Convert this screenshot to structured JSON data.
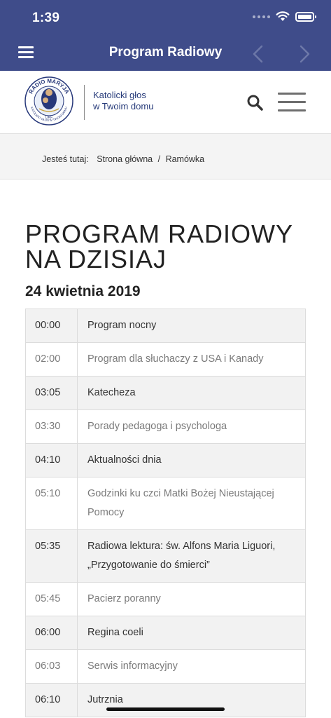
{
  "status_bar": {
    "time": "1:39"
  },
  "nav": {
    "title": "Program Radiowy"
  },
  "header": {
    "logo_text_top": "RADIO MARYJA",
    "logo_text_bottom": "KATOLICKI GŁOS W TWOIM DOMU",
    "logo_text_center": "UKF",
    "tagline_line1": "Katolicki głos",
    "tagline_line2": "w Twoim domu"
  },
  "breadcrumb": {
    "prefix": "Jesteś tutaj:",
    "home": "Strona główna",
    "separator": "/",
    "current": "Ramówka"
  },
  "page": {
    "title": "PROGRAM RADIOWY NA DZISIAJ",
    "date": "24 kwietnia 2019"
  },
  "schedule": [
    {
      "time": "00:00",
      "program": "Program nocny"
    },
    {
      "time": "02:00",
      "program": "Program dla słuchaczy z USA i Kanady"
    },
    {
      "time": "03:05",
      "program": "Katecheza"
    },
    {
      "time": "03:30",
      "program": "Porady pedagoga i psychologa"
    },
    {
      "time": "04:10",
      "program": "Aktualności dnia"
    },
    {
      "time": "05:10",
      "program": "Godzinki ku czci Matki Bożej Nieustającej Pomocy"
    },
    {
      "time": "05:35",
      "program": "Radiowa lektura: św. Alfons Maria Liguori, „Przygotowanie do śmierci”"
    },
    {
      "time": "05:45",
      "program": "Pacierz poranny"
    },
    {
      "time": "06:00",
      "program": "Regina coeli"
    },
    {
      "time": "06:03",
      "program": "Serwis informacyjny"
    },
    {
      "time": "06:10",
      "program": "Jutrznia"
    }
  ],
  "colors": {
    "nav_bg": "#3f4c8a",
    "tagline": "#273b7a",
    "row_alt": "#f2f2f2"
  }
}
